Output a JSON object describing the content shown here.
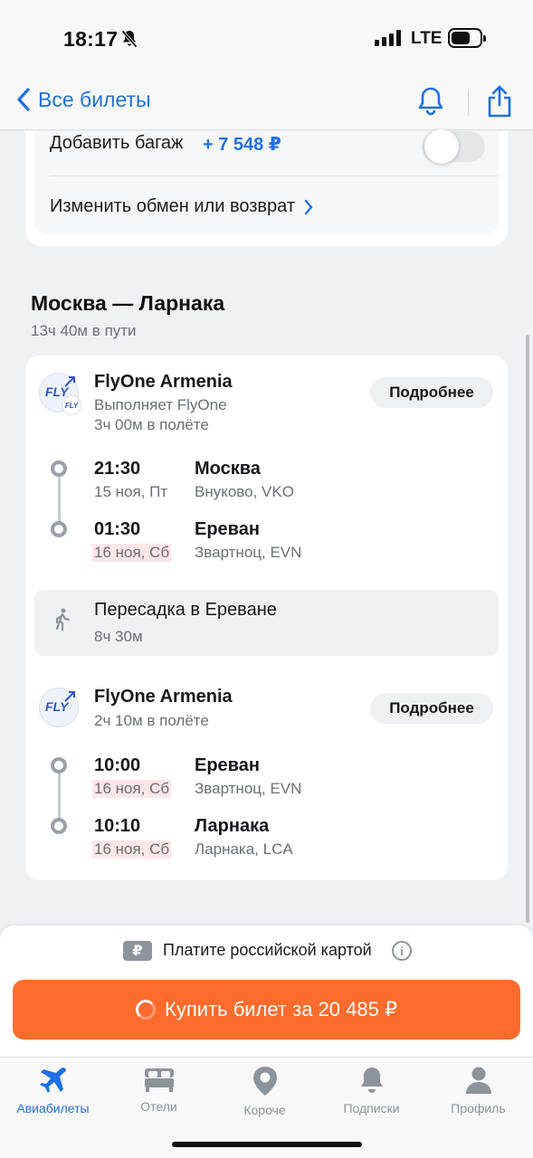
{
  "status": {
    "time": "18:17",
    "network": "LTE"
  },
  "nav": {
    "back_label": "Все билеты"
  },
  "options": {
    "baggage_label": "Добавить багаж",
    "baggage_price": "+ 7 548 ₽",
    "baggage_enabled": false,
    "change_link": "Изменить обмен или возврат"
  },
  "route": {
    "title": "Москва — Ларнака",
    "duration": "13ч 40м в пути"
  },
  "segments": [
    {
      "airline": "FlyOne Armenia",
      "operator": "Выполняет FlyOne",
      "flight_time": "3ч 00м в полёте",
      "details_label": "Подробнее",
      "logo_text": "FLY",
      "departure": {
        "time": "21:30",
        "date": "15 ноя, Пт",
        "city": "Москва",
        "airport": "Внуково, VKO"
      },
      "arrival": {
        "time": "01:30",
        "date": "16 ноя, Сб",
        "city": "Ереван",
        "airport": "Звартноц, EVN"
      }
    },
    {
      "airline": "FlyOne Armenia",
      "flight_time": "2ч 10м в полёте",
      "details_label": "Подробнее",
      "logo_text": "FLY",
      "departure": {
        "time": "10:00",
        "date": "16 ноя, Сб",
        "city": "Ереван",
        "airport": "Звартноц, EVN"
      },
      "arrival": {
        "time": "10:10",
        "date": "16 ноя, Сб",
        "city": "Ларнака",
        "airport": "Ларнака, LCA"
      }
    }
  ],
  "transfer": {
    "title": "Пересадка в Ереване",
    "duration": "8ч 30м"
  },
  "purchase": {
    "currency_badge": "₽",
    "pay_note": "Платите российской картой",
    "info_badge": "i",
    "button_label": "Купить билет за 20 485 ₽"
  },
  "tabs": [
    {
      "label": "Авиабилеты",
      "icon": "plane-icon",
      "active": true
    },
    {
      "label": "Отели",
      "icon": "bed-icon",
      "active": false
    },
    {
      "label": "Короче",
      "icon": "location-pin-icon",
      "active": false
    },
    {
      "label": "Подписки",
      "icon": "bell-icon",
      "active": false
    },
    {
      "label": "Профиль",
      "icon": "person-icon",
      "active": false
    }
  ],
  "colors": {
    "accent": "#1f6fe6",
    "cta": "#ff6b2c",
    "date_highlight": "#fde6e8"
  }
}
